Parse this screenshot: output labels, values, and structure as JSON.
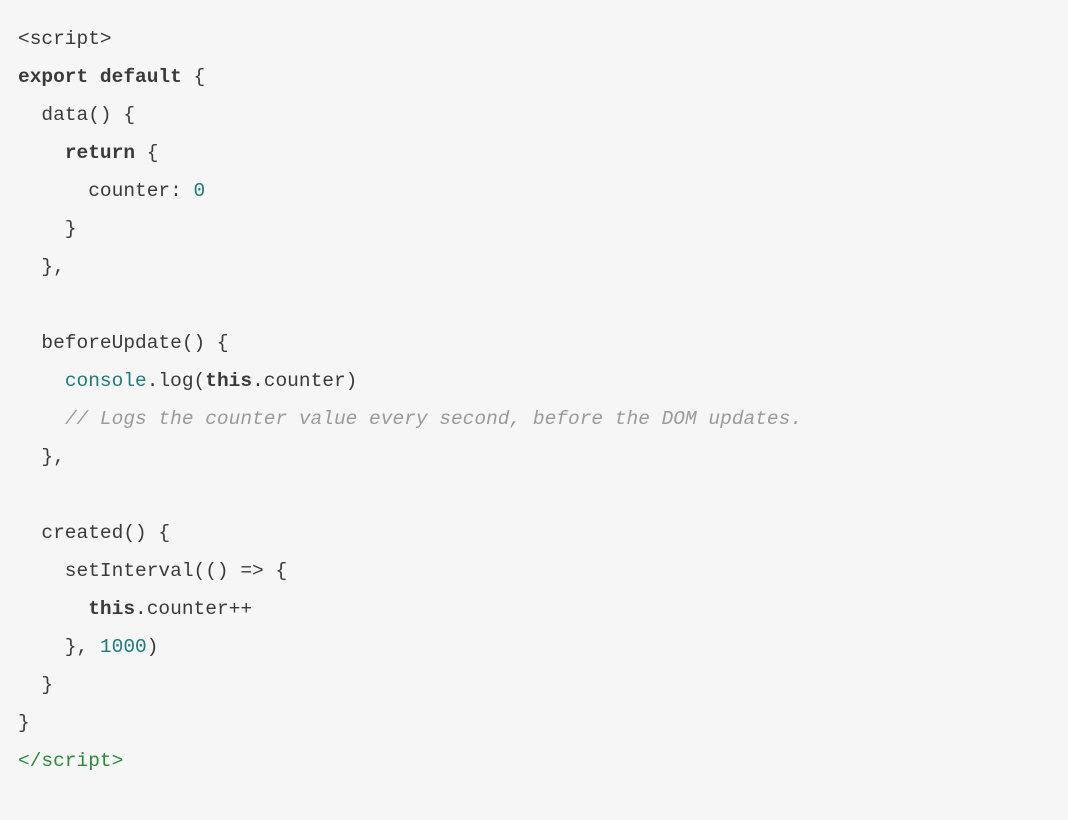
{
  "code": {
    "l1_open": "<script>",
    "l2_kw1": "export",
    "l2_kw2": "default",
    "l2_brace": " {",
    "l3": "  data() {",
    "l4_indent": "    ",
    "l4_kw": "return",
    "l4_brace": " {",
    "l5_indent": "      counter: ",
    "l5_num": "0",
    "l6": "    }",
    "l7": "  },",
    "l8": "",
    "l9": "  beforeUpdate() {",
    "l10_indent": "    ",
    "l10_console": "console",
    "l10_dotlog": ".log(",
    "l10_this": "this",
    "l10_rest": ".counter)",
    "l11_indent": "    ",
    "l11_comment": "// Logs the counter value every second, before the DOM updates.",
    "l12": "  },",
    "l13": "",
    "l14": "  created() {",
    "l15": "    setInterval(() => {",
    "l16_indent": "      ",
    "l16_this": "this",
    "l16_rest": ".counter++",
    "l17_indent": "    }, ",
    "l17_num": "1000",
    "l17_paren": ")",
    "l18": "  }",
    "l19": "}",
    "l20_close_lt": "</",
    "l20_close_name": "script",
    "l20_close_gt": ">"
  }
}
